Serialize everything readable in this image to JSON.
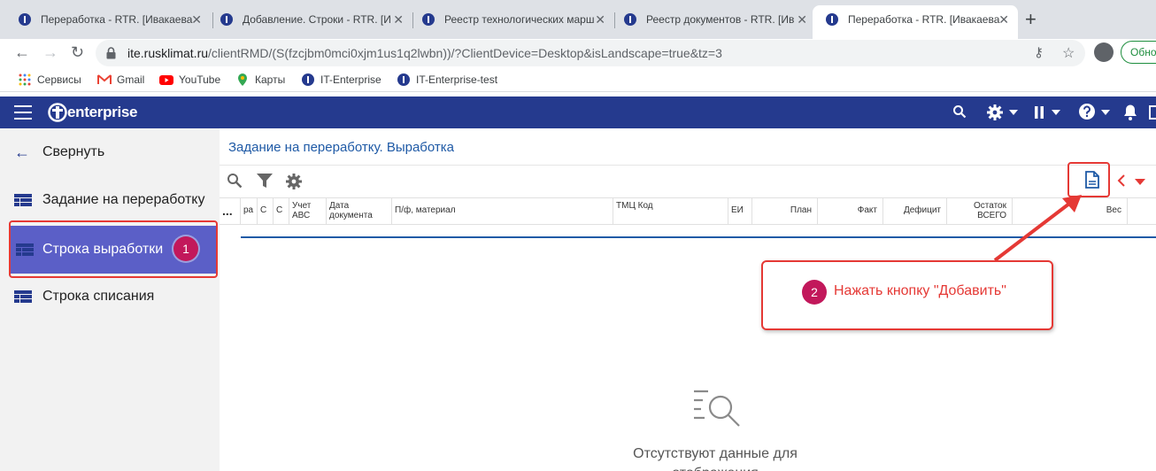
{
  "browser": {
    "tabs": [
      {
        "title": "Переработка - RTR. [Ивакаева",
        "active": false
      },
      {
        "title": "Добавление. Строки - RTR. [И",
        "active": false
      },
      {
        "title": "Реестр технологических марш",
        "active": false
      },
      {
        "title": "Реестр документов - RTR. [Ив",
        "active": false
      },
      {
        "title": "Переработка - RTR. [Ивакаева",
        "active": true
      }
    ],
    "tab_close": "✕",
    "new_tab": "+",
    "url_host": "ite.rusklimat.ru",
    "url_rest": "/clientRMD/(S(fzcjbm0mci0xjm1us1q2lwbn))/?ClientDevice=Desktop&isLandscape=true&tz=3",
    "update_label": "Обно",
    "bookmarks": [
      "Сервисы",
      "Gmail",
      "YouTube",
      "Карты",
      "IT-Enterprise",
      "IT-Enterprise-test"
    ]
  },
  "app": {
    "logo_text": "enterprise",
    "brand_color": "#253a8e"
  },
  "sidebar": {
    "collapse_label": "Свернуть",
    "items": [
      {
        "label": "Задание на переработку",
        "active": false
      },
      {
        "label": "Строка выработки",
        "active": true
      },
      {
        "label": "Строка списания",
        "active": false
      }
    ]
  },
  "main": {
    "title": "Задание на переработку. Выработка",
    "columns": [
      {
        "label": "..."
      },
      {
        "label": "ра"
      },
      {
        "label": "С"
      },
      {
        "label": "С"
      },
      {
        "label": "Учет АВС"
      },
      {
        "label": "Дата документа"
      },
      {
        "label": "П/ф, материал"
      },
      {
        "label": "ТМЦ Код"
      },
      {
        "label": "ЕИ"
      },
      {
        "label": "План"
      },
      {
        "label": "Факт"
      },
      {
        "label": "Дефицит"
      },
      {
        "label": "Остаток ВСЕГО"
      },
      {
        "label": "Вес"
      }
    ],
    "empty_text": "Отсутствуют данные для отображения"
  },
  "annotations": {
    "badge1": "1",
    "badge2": "2",
    "callout_text": "Нажать кнопку \"Добавить\"",
    "accent": "#e53935"
  }
}
